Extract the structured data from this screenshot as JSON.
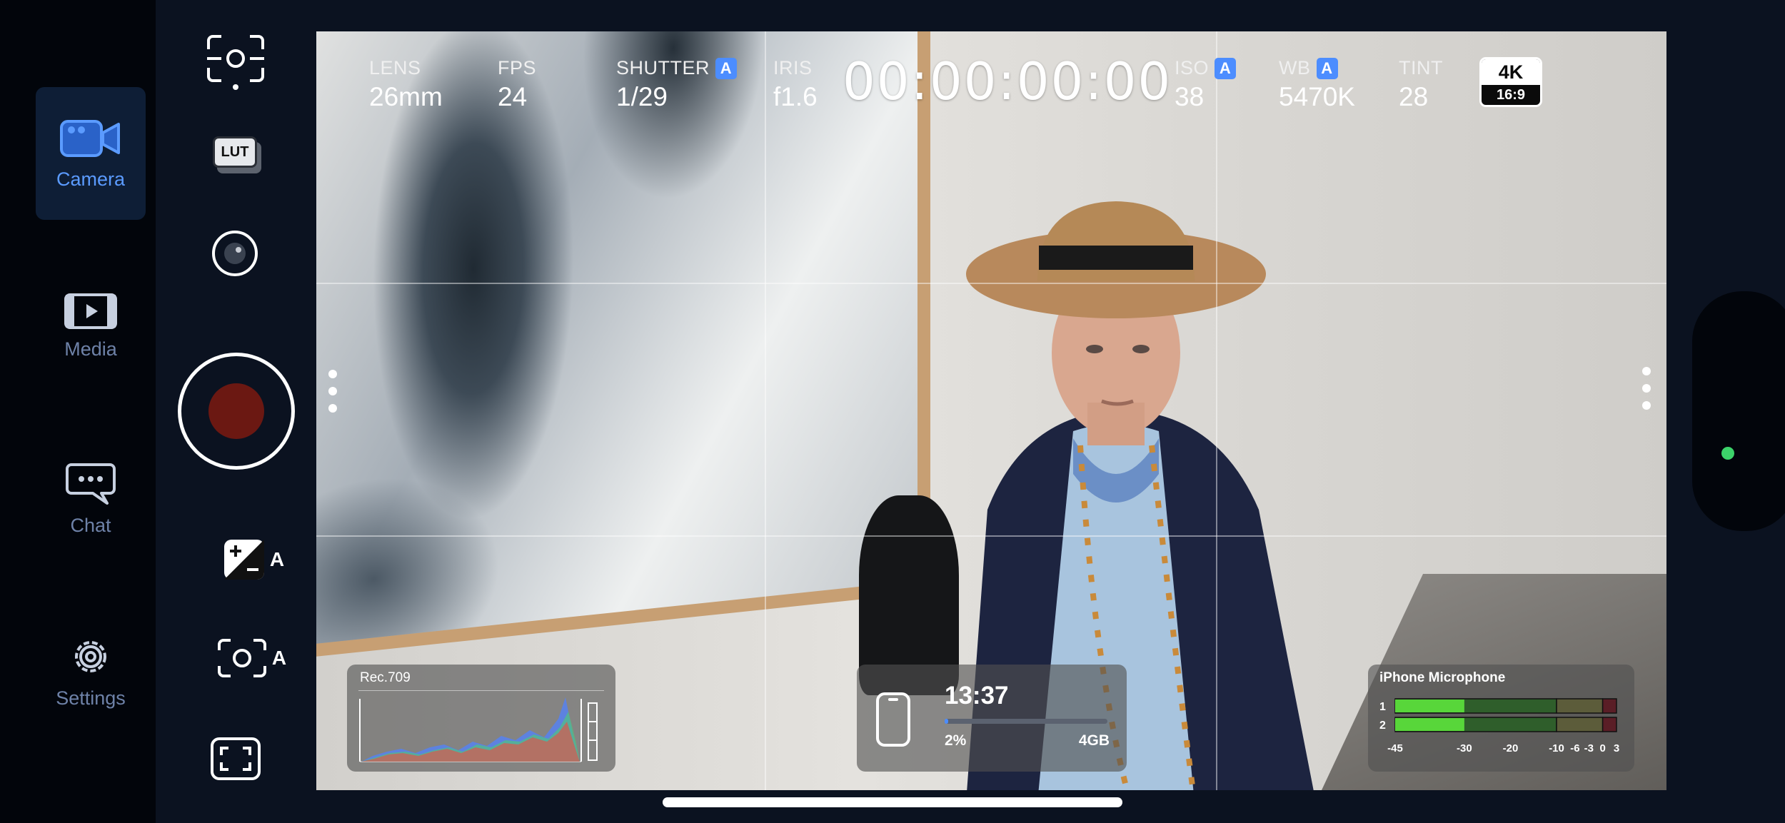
{
  "nav": {
    "camera_label": "Camera",
    "media_label": "Media",
    "chat_label": "Chat",
    "settings_label": "Settings"
  },
  "tools": {
    "lut_label": "LUT",
    "auto_exposure_label": "A",
    "auto_focus_label": "A"
  },
  "hud": {
    "lens": {
      "label": "LENS",
      "value": "26mm"
    },
    "fps": {
      "label": "FPS",
      "value": "24"
    },
    "shutter": {
      "label": "SHUTTER",
      "badge": "A",
      "value": "1/29"
    },
    "iris": {
      "label": "IRIS",
      "value": "f1.6"
    },
    "timecode": "00:00:00:00",
    "iso": {
      "label": "ISO",
      "badge": "A",
      "value": "38"
    },
    "wb": {
      "label": "WB",
      "badge": "A",
      "value": "5470K"
    },
    "tint": {
      "label": "TINT",
      "value": "28"
    },
    "resolution": "4K",
    "aspect": "16:9"
  },
  "histogram": {
    "title": "Rec.709"
  },
  "storage": {
    "time_remaining": "13:37",
    "percent_used_label": "2%",
    "percent_used": 0.02,
    "capacity": "4GB"
  },
  "audio": {
    "title": "iPhone Microphone",
    "channels": [
      {
        "label": "1",
        "level_db": -30
      },
      {
        "label": "2",
        "level_db": -30
      }
    ],
    "scale": [
      "-45",
      "-30",
      "-20",
      "-10",
      "-6",
      "-3",
      "0",
      "3"
    ]
  },
  "colors": {
    "accent": "#4c8dff",
    "record": "#6b1812",
    "status_ok": "#3cd36a"
  }
}
